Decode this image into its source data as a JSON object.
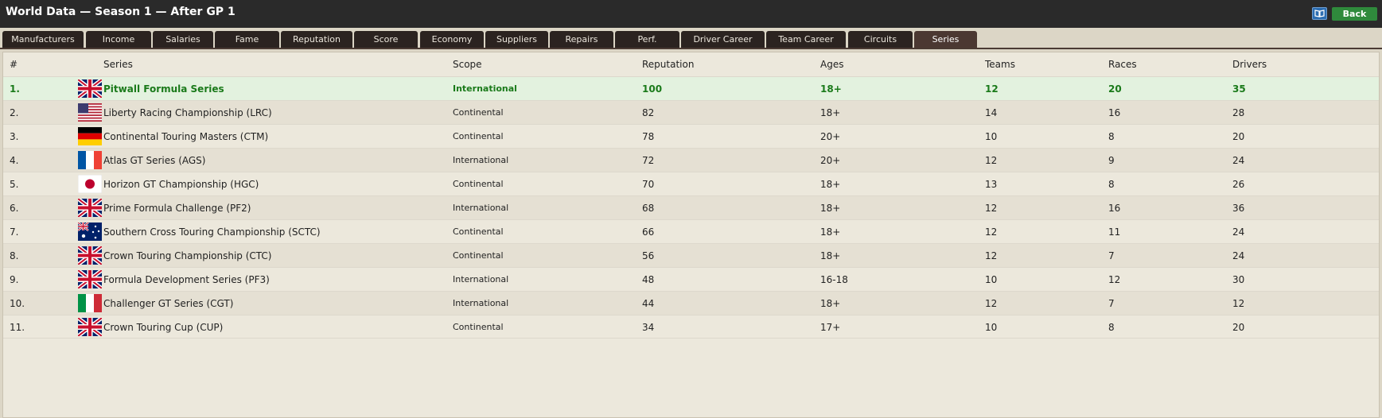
{
  "window": {
    "title": "World Data — Season 1 — After GP 1",
    "back_label": "Back"
  },
  "tabs": [
    {
      "label": "Manufacturers",
      "active": false
    },
    {
      "label": "Income",
      "active": false
    },
    {
      "label": "Salaries",
      "active": false
    },
    {
      "label": "Fame",
      "active": false
    },
    {
      "label": "Reputation",
      "active": false
    },
    {
      "label": "Score",
      "active": false
    },
    {
      "label": "Economy",
      "active": false
    },
    {
      "label": "Suppliers",
      "active": false
    },
    {
      "label": "Repairs",
      "active": false
    },
    {
      "label": "Perf.",
      "active": false
    },
    {
      "label": "Driver Career",
      "active": false
    },
    {
      "label": "Team Career",
      "active": false
    },
    {
      "label": "Circuits",
      "active": false
    },
    {
      "label": "Series",
      "active": true
    }
  ],
  "table": {
    "columns": [
      "#",
      "Series",
      "Scope",
      "Reputation",
      "Ages",
      "Teams",
      "Races",
      "Drivers"
    ],
    "rows": [
      {
        "rank": "1.",
        "flag": "uk-flag-icon",
        "series": "Pitwall Formula Series",
        "scope": "International",
        "reputation": "100",
        "ages": "18+",
        "teams": "12",
        "races": "20",
        "drivers": "35"
      },
      {
        "rank": "2.",
        "flag": "us-flag-icon",
        "series": "Liberty Racing Championship (LRC)",
        "scope": "Continental",
        "reputation": "82",
        "ages": "18+",
        "teams": "14",
        "races": "16",
        "drivers": "28"
      },
      {
        "rank": "3.",
        "flag": "germany-flag-icon",
        "series": "Continental Touring Masters (CTM)",
        "scope": "Continental",
        "reputation": "78",
        "ages": "20+",
        "teams": "10",
        "races": "8",
        "drivers": "20"
      },
      {
        "rank": "4.",
        "flag": "france-flag-icon",
        "series": "Atlas GT Series (AGS)",
        "scope": "International",
        "reputation": "72",
        "ages": "20+",
        "teams": "12",
        "races": "9",
        "drivers": "24"
      },
      {
        "rank": "5.",
        "flag": "japan-flag-icon",
        "series": "Horizon GT Championship (HGC)",
        "scope": "Continental",
        "reputation": "70",
        "ages": "18+",
        "teams": "13",
        "races": "8",
        "drivers": "26"
      },
      {
        "rank": "6.",
        "flag": "uk-flag-icon",
        "series": "Prime Formula Challenge (PF2)",
        "scope": "International",
        "reputation": "68",
        "ages": "18+",
        "teams": "12",
        "races": "16",
        "drivers": "36"
      },
      {
        "rank": "7.",
        "flag": "australia-flag-icon",
        "series": "Southern Cross Touring Championship (SCTC)",
        "scope": "Continental",
        "reputation": "66",
        "ages": "18+",
        "teams": "12",
        "races": "11",
        "drivers": "24"
      },
      {
        "rank": "8.",
        "flag": "uk-flag-icon",
        "series": "Crown Touring Championship (CTC)",
        "scope": "Continental",
        "reputation": "56",
        "ages": "18+",
        "teams": "12",
        "races": "7",
        "drivers": "24"
      },
      {
        "rank": "9.",
        "flag": "uk-flag-icon",
        "series": "Formula Development Series (PF3)",
        "scope": "International",
        "reputation": "48",
        "ages": "16-18",
        "teams": "10",
        "races": "12",
        "drivers": "30"
      },
      {
        "rank": "10.",
        "flag": "italy-flag-icon",
        "series": "Challenger GT Series (CGT)",
        "scope": "International",
        "reputation": "44",
        "ages": "18+",
        "teams": "12",
        "races": "7",
        "drivers": "12"
      },
      {
        "rank": "11.",
        "flag": "uk-flag-icon",
        "series": "Crown Touring Cup (CUP)",
        "scope": "Continental",
        "reputation": "34",
        "ages": "17+",
        "teams": "10",
        "races": "8",
        "drivers": "20"
      }
    ]
  },
  "colors": {
    "titlebar": "#2a2a2a",
    "tab": "#2b2320",
    "tab_active": "#4b3832",
    "back_button": "#2f8a3c",
    "highlight_row": "#e3f2df",
    "highlight_text": "#1a7a1a"
  }
}
